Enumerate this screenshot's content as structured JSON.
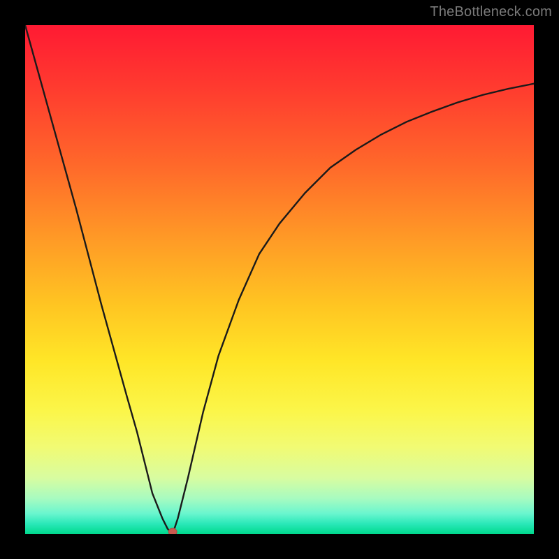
{
  "watermark": "TheBottleneck.com",
  "colors": {
    "frame": "#000000",
    "curve_stroke": "#1a1a1a",
    "marker_fill": "#c95a4f",
    "marker_stroke": "#b24a40"
  },
  "chart_data": {
    "type": "line",
    "title": "",
    "xlabel": "",
    "ylabel": "",
    "xlim": [
      0,
      100
    ],
    "ylim": [
      0,
      100
    ],
    "grid": false,
    "legend": false,
    "x": [
      0,
      5,
      10,
      15,
      20,
      22,
      24,
      25,
      27,
      28,
      29,
      30,
      32,
      35,
      38,
      42,
      46,
      50,
      55,
      60,
      65,
      70,
      75,
      80,
      85,
      90,
      95,
      100
    ],
    "values": [
      100,
      82,
      64,
      45,
      27,
      20,
      12,
      8,
      3,
      1,
      0,
      3,
      11,
      24,
      35,
      46,
      55,
      61,
      67,
      72,
      75.5,
      78.5,
      81,
      83,
      84.8,
      86.3,
      87.5,
      88.5
    ],
    "marker": {
      "x": 29,
      "y": 0
    },
    "annotations": []
  }
}
